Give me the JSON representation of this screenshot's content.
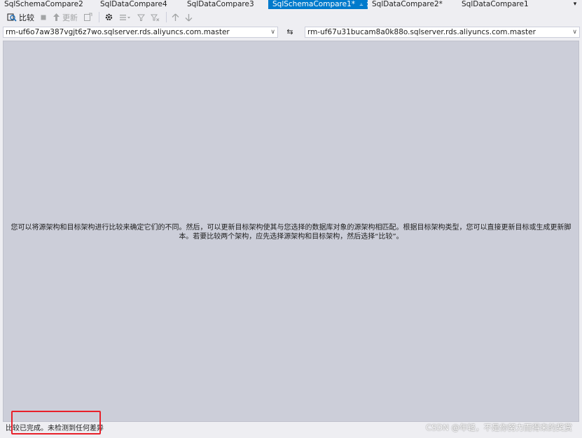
{
  "tabs": [
    {
      "label": "SqlSchemaCompare2",
      "active": false
    },
    {
      "label": "SqlDataCompare4",
      "active": false
    },
    {
      "label": "SqlDataCompare3",
      "active": false
    },
    {
      "label": "SqlSchemaCompare1*",
      "active": true
    },
    {
      "label": "SqlDataCompare2*",
      "active": false
    },
    {
      "label": "SqlDataCompare1",
      "active": false
    }
  ],
  "toolbar": {
    "compare_label": "比较",
    "update_label": "更新"
  },
  "connections": {
    "source": "rm-uf6o7aw387vgjt6z7wo.sqlserver.rds.aliyuncs.com.master",
    "target": "rm-uf67u31bucam8a0k88o.sqlserver.rds.aliyuncs.com.master"
  },
  "main": {
    "message": "您可以将源架构和目标架构进行比较来确定它们的不同。然后，可以更新目标架构使其与您选择的数据库对象的源架构相匹配。根据目标架构类型，您可以直接更新目标或生成更新脚本。若要比较两个架构，应先选择源架构和目标架构，然后选择“比较”。"
  },
  "status": {
    "text": "比较已完成。未检测到任何差异"
  },
  "watermark": "CSDN @年轻，不是你努力而得来的奖赏",
  "colors": {
    "accent": "#007acc",
    "panel": "#ccced9",
    "highlight": "#e8202a"
  }
}
